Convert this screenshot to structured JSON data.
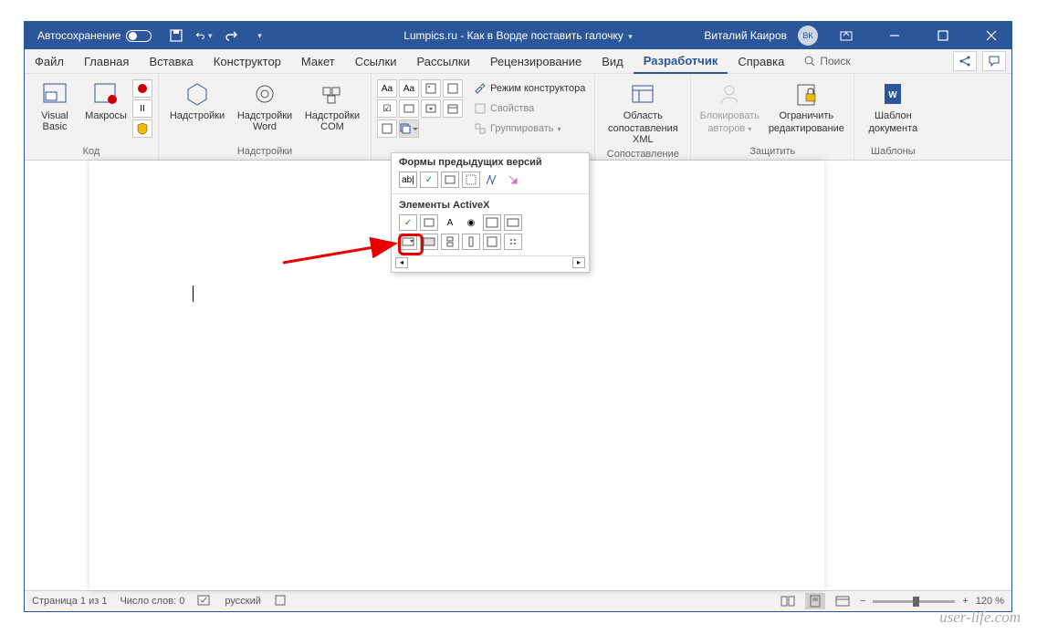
{
  "titlebar": {
    "autosave_label": "Автосохранение",
    "title": "Lumpics.ru - Как в Ворде поставить галочку",
    "user_name": "Виталий Каиров",
    "user_initials": "ВК"
  },
  "tabs": {
    "items": [
      "Файл",
      "Главная",
      "Вставка",
      "Конструктор",
      "Макет",
      "Ссылки",
      "Рассылки",
      "Рецензирование",
      "Вид",
      "Разработчик",
      "Справка"
    ],
    "active_index": 9,
    "search_label": "Поиск"
  },
  "ribbon": {
    "group_code": "Код",
    "group_addins": "Надстройки",
    "group_mapping": "Сопоставление",
    "group_protect": "Защитить",
    "group_templates": "Шаблоны",
    "visual_basic": "Visual Basic",
    "macros": "Макросы",
    "addins": "Надстройки",
    "addins_word": "Надстройки Word",
    "addins_com": "Надстройки COM",
    "design_mode": "Режим конструктора",
    "properties": "Свойства",
    "group_btn": "Группировать",
    "xml_mapping_l1": "Область",
    "xml_mapping_l2": "сопоставления XML",
    "block_l1": "Блокировать",
    "block_l2": "авторов",
    "restrict_l1": "Ограничить",
    "restrict_l2": "редактирование",
    "template_l1": "Шаблон",
    "template_l2": "документа"
  },
  "popup": {
    "legacy_title": "Формы предыдущих версий",
    "activex_title": "Элементы ActiveX"
  },
  "statusbar": {
    "page": "Страница 1 из 1",
    "words": "Число слов: 0",
    "language": "русский",
    "zoom": "120 %"
  },
  "watermark": "user-life.com"
}
